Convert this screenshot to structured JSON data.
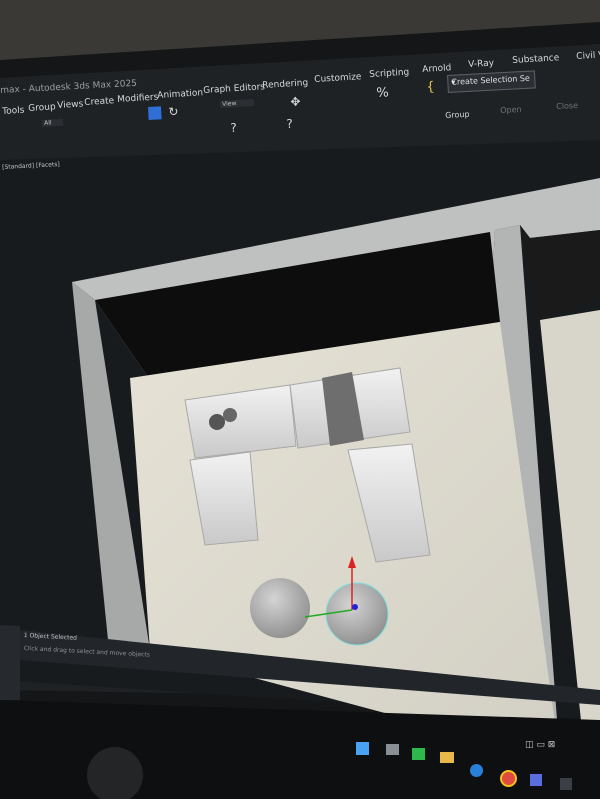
{
  "window": {
    "title_fragment": "max - Autodesk 3ds Max 2025"
  },
  "menubar": {
    "items": [
      "Tools",
      "Group",
      "Views",
      "Create",
      "Modifiers",
      "Animation",
      "Graph Editors",
      "Rendering",
      "Customize",
      "Scripting",
      "Arnold",
      "V-Ray",
      "Substance",
      "Civil V"
    ]
  },
  "toolbar": {
    "all_filter": "All",
    "view_dropdown": "View",
    "selection_set": "Create Selection Se",
    "group_label": "Group",
    "open_label": "Open",
    "close_label": "Close"
  },
  "viewport": {
    "label": "[Standard] [Facets]"
  },
  "status": {
    "selection": "1 Object Selected",
    "hint": "Click and drag to select and move objects"
  },
  "taskbar": {
    "icons": [
      "start-icon",
      "search-icon",
      "task-view-icon",
      "chat-icon",
      "file-explorer-icon",
      "edge-icon",
      "chrome-icon",
      "store-icon",
      "app-icon"
    ]
  }
}
